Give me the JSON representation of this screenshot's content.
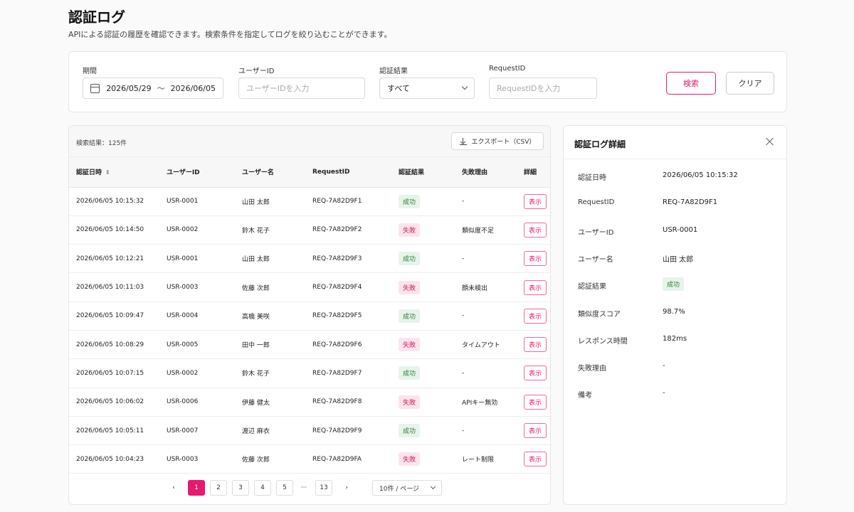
{
  "page": {
    "title": "認証ログ",
    "description": "APIによる認証の履歴を確認できます。検索条件を指定してログを絞り込むことができます。"
  },
  "filters": {
    "period_label": "期間",
    "date_from": "2026/05/29",
    "date_sep": "〜",
    "date_to": "2026/06/05",
    "user_id_label": "ユーザーID",
    "user_id_placeholder": "ユーザーIDを入力",
    "result_label": "認証結果",
    "result_value": "すべて",
    "request_id_label": "RequestID",
    "request_id_placeholder": "RequestIDを入力",
    "search_button": "検索",
    "clear_button": "クリア"
  },
  "results": {
    "count_text": "検索結果：125件",
    "export_label": "エクスポート（CSV）",
    "columns": [
      "認証日時",
      "ユーザーID",
      "ユーザー名",
      "RequestID",
      "認証結果",
      "失敗理由",
      "詳細"
    ],
    "view_label": "表示",
    "rows": [
      {
        "datetime": "2026/06/05 10:15:32",
        "user_id": "USR-0001",
        "user_name": "山田 太郎",
        "request_id": "REQ-7A82D9F1",
        "result": "成功",
        "status": "ok",
        "reason": "-"
      },
      {
        "datetime": "2026/06/05 10:14:50",
        "user_id": "USR-0002",
        "user_name": "鈴木 花子",
        "request_id": "REQ-7A82D9F2",
        "result": "失敗",
        "status": "ng",
        "reason": "類似度不足"
      },
      {
        "datetime": "2026/06/05 10:12:21",
        "user_id": "USR-0001",
        "user_name": "山田 太郎",
        "request_id": "REQ-7A82D9F3",
        "result": "成功",
        "status": "ok",
        "reason": "-"
      },
      {
        "datetime": "2026/06/05 10:11:03",
        "user_id": "USR-0003",
        "user_name": "佐藤 次郎",
        "request_id": "REQ-7A82D9F4",
        "result": "失敗",
        "status": "ng",
        "reason": "顔未検出"
      },
      {
        "datetime": "2026/06/05 10:09:47",
        "user_id": "USR-0004",
        "user_name": "高橋 美咲",
        "request_id": "REQ-7A82D9F5",
        "result": "成功",
        "status": "ok",
        "reason": "-"
      },
      {
        "datetime": "2026/06/05 10:08:29",
        "user_id": "USR-0005",
        "user_name": "田中 一郎",
        "request_id": "REQ-7A82D9F6",
        "result": "失敗",
        "status": "ng",
        "reason": "タイムアウト"
      },
      {
        "datetime": "2026/06/05 10:07:15",
        "user_id": "USR-0002",
        "user_name": "鈴木 花子",
        "request_id": "REQ-7A82D9F7",
        "result": "成功",
        "status": "ok",
        "reason": "-"
      },
      {
        "datetime": "2026/06/05 10:06:02",
        "user_id": "USR-0006",
        "user_name": "伊藤 健太",
        "request_id": "REQ-7A82D9F8",
        "result": "失敗",
        "status": "ng",
        "reason": "APIキー無効"
      },
      {
        "datetime": "2026/06/05 10:05:11",
        "user_id": "USR-0007",
        "user_name": "渡辺 麻衣",
        "request_id": "REQ-7A82D9F9",
        "result": "成功",
        "status": "ok",
        "reason": "-"
      },
      {
        "datetime": "2026/06/05 10:04:23",
        "user_id": "USR-0003",
        "user_name": "佐藤 次郎",
        "request_id": "REQ-7A82D9FA",
        "result": "失敗",
        "status": "ng",
        "reason": "レート制限"
      }
    ]
  },
  "pagination": {
    "prev": "‹",
    "pages": [
      "1",
      "2",
      "3",
      "4",
      "5"
    ],
    "ellipsis": "···",
    "last": "13",
    "next": "›",
    "current": "1",
    "page_size": "10件 / ページ"
  },
  "detail": {
    "title": "認証ログ詳細",
    "items": [
      {
        "key": "認証日時",
        "value": "2026/06/05 10:15:32"
      },
      {
        "key": "RequestID",
        "value": "REQ-7A82D9F1"
      },
      {
        "key": "ユーザーID",
        "value": "USR-0001"
      },
      {
        "key": "ユーザー名",
        "value": "山田 太郎"
      },
      {
        "key": "認証結果",
        "value": "成功",
        "badge": "ok"
      },
      {
        "key": "類似度スコア",
        "value": "98.7%"
      },
      {
        "key": "レスポンス時間",
        "value": "182ms"
      },
      {
        "key": "失敗理由",
        "value": "-"
      },
      {
        "key": "備考",
        "value": "-"
      }
    ]
  },
  "colors": {
    "accent": "#e5196f",
    "success_bg": "#e6f4ea",
    "success_text": "#2e7d32",
    "fail_bg": "#fde4ec",
    "fail_text": "#d81b60"
  },
  "icons": {
    "calendar": "calendar-icon",
    "dropdown": "chevron-down-icon",
    "download": "download-icon",
    "close": "close-icon",
    "sort": "sort-icon"
  }
}
